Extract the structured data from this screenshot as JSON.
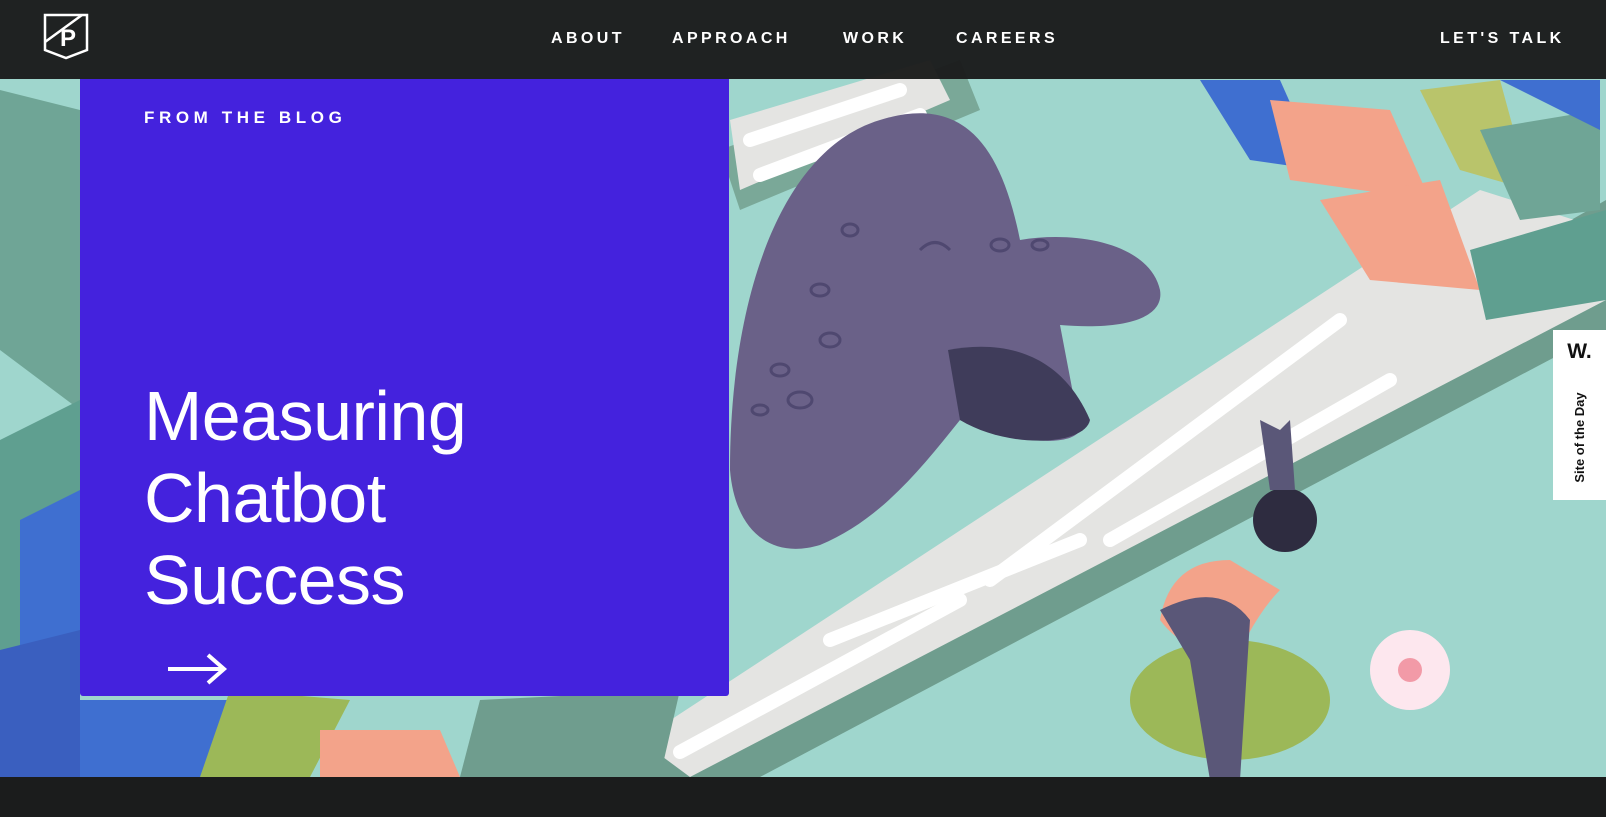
{
  "nav": {
    "logo_letter": "P",
    "links": [
      "ABOUT",
      "APPROACH",
      "WORK",
      "CAREERS"
    ],
    "cta": "LET'S TALK"
  },
  "card": {
    "eyebrow": "FROM THE BLOG",
    "headline_lines": [
      "Measuring",
      "Chatbot",
      "Success"
    ],
    "arrow_icon": "arrow-right-icon"
  },
  "badge": {
    "mark": "W.",
    "text": "Site of the Day"
  },
  "colors": {
    "nav_bg": "#1b1c1c",
    "card_bg": "#4422dd",
    "hero_bg": "#9fd6cd"
  }
}
